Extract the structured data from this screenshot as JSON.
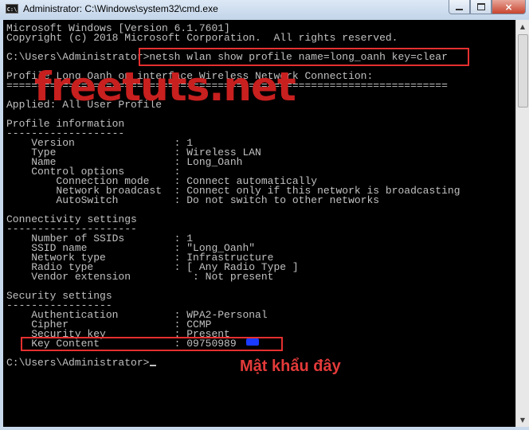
{
  "window": {
    "title": "Administrator: C:\\Windows\\system32\\cmd.exe",
    "icon_label": "C:\\",
    "close_glyph": "×"
  },
  "console": {
    "lines": [
      "Microsoft Windows [Version 6.1.7601]",
      "Copyright (c) 2018 Microsoft Corporation.  All rights reserved.",
      "",
      "C:\\Users\\Administrator>netsh wlan show profile name=long_oanh key=clear",
      "",
      "Profile Long_Oanh on interface Wireless Network Connection:",
      "=======================================================================",
      "",
      "Applied: All User Profile",
      "",
      "Profile information",
      "-------------------",
      "    Version                : 1",
      "    Type                   : Wireless LAN",
      "    Name                   : Long_Oanh",
      "    Control options        :",
      "        Connection mode    : Connect automatically",
      "        Network broadcast  : Connect only if this network is broadcasting",
      "        AutoSwitch         : Do not switch to other networks",
      "",
      "Connectivity settings",
      "---------------------",
      "    Number of SSIDs        : 1",
      "    SSID name              : \"Long_Oanh\"",
      "    Network type           : Infrastructure",
      "    Radio type             : [ Any Radio Type ]",
      "    Vendor extension          : Not present",
      "",
      "Security settings",
      "-----------------",
      "    Authentication         : WPA2-Personal",
      "    Cipher                 : CCMP",
      "    Security key           : Present",
      "    Key Content            : 09750989",
      "",
      "C:\\Users\\Administrator>"
    ]
  },
  "overlay": {
    "watermark": "freetuts.net",
    "annotation": "Mật khẩu đây"
  },
  "colors": {
    "console_bg": "#000000",
    "console_text": "#c0c0c0",
    "highlight": "#e52f2f",
    "watermark": "#c81f1f",
    "redaction": "#1a3aff"
  },
  "icons": [
    "cmd-app-icon",
    "minimize-icon",
    "maximize-icon",
    "close-icon",
    "scroll-up-icon",
    "scroll-down-icon"
  ]
}
